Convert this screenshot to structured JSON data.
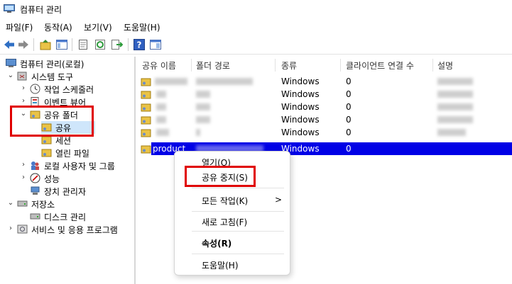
{
  "window": {
    "title": "컴퓨터 관리"
  },
  "menu": [
    "파일(F)",
    "동작(A)",
    "보기(V)",
    "도움말(H)"
  ],
  "toolbar": {
    "buttons": [
      "back-arrow-icon",
      "forward-arrow-icon",
      "folder-up-icon",
      "console-tree-icon",
      "properties-icon",
      "refresh-icon",
      "export-icon",
      "help-icon",
      "show-pane-icon"
    ]
  },
  "tree": {
    "root": "컴퓨터 관리(로컬)",
    "system_tools": "시스템 도구",
    "task_scheduler": "작업 스케줄러",
    "event_viewer": "이벤트 뷰어",
    "shared_folders": "공유 폴더",
    "shares": "공유",
    "sessions": "세션",
    "open_files": "열린 파일",
    "local_users": "로컬 사용자 및 그룹",
    "performance": "성능",
    "device_manager": "장치 관리자",
    "storage": "저장소",
    "disk_management": "디스크 관리",
    "services_apps": "서비스 및 응용 프로그램"
  },
  "list": {
    "headers": [
      "공유 이름",
      "폴더 경로",
      "종류",
      "클라이언트 연결 수",
      "설명"
    ],
    "rows": [
      {
        "type": "Windows",
        "clients": "0"
      },
      {
        "type": "Windows",
        "clients": "0"
      },
      {
        "type": "Windows",
        "clients": "0"
      },
      {
        "type": "Windows",
        "clients": "0"
      },
      {
        "type": "Windows",
        "clients": "0"
      },
      {
        "name": "product",
        "type": "Windows",
        "clients": "0"
      }
    ]
  },
  "context_menu": {
    "open": "열기(O)",
    "stop_sharing": "공유 중지(S)",
    "all_tasks": "모든 작업(K)",
    "all_tasks_arrow": ">",
    "refresh": "새로 고침(F)",
    "properties": "속성(R)",
    "help": "도움말(H)"
  },
  "colors": {
    "selection": "#0000e6",
    "highlight_box": "#e00000",
    "tree_selected": "#cfe6fb"
  }
}
